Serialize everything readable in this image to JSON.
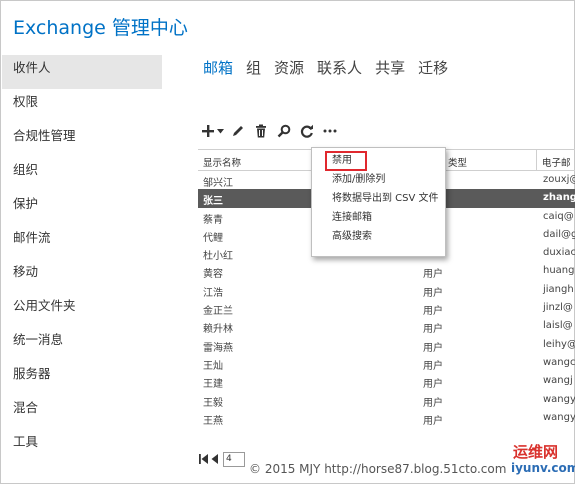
{
  "app": {
    "title": "Exchange 管理中心"
  },
  "sidebar": {
    "items": [
      {
        "label": "收件人",
        "active": true
      },
      {
        "label": "权限"
      },
      {
        "label": "合规性管理"
      },
      {
        "label": "组织"
      },
      {
        "label": "保护"
      },
      {
        "label": "邮件流"
      },
      {
        "label": "移动"
      },
      {
        "label": "公用文件夹"
      },
      {
        "label": "统一消息"
      },
      {
        "label": "服务器"
      },
      {
        "label": "混合"
      },
      {
        "label": "工具"
      }
    ]
  },
  "tabs": [
    {
      "label": "邮箱",
      "active": true
    },
    {
      "label": "组"
    },
    {
      "label": "资源"
    },
    {
      "label": "联系人"
    },
    {
      "label": "共享"
    },
    {
      "label": "迁移"
    }
  ],
  "toolbar": {
    "icons": [
      "add-icon",
      "dropdown-arrow-icon",
      "edit-icon",
      "delete-icon",
      "search-icon",
      "refresh-icon",
      "more-icon"
    ]
  },
  "grid": {
    "headers": {
      "name": "显示名称",
      "type": "类型",
      "email": "电子邮"
    },
    "rows": [
      {
        "name": "邹兴江",
        "type": "",
        "email": "zouxj@"
      },
      {
        "name": "张三",
        "type": "",
        "email": "zhang",
        "selected": true
      },
      {
        "name": "蔡青",
        "type": "",
        "email": "caiq@"
      },
      {
        "name": "代鲤",
        "type": "",
        "email": "dail@g"
      },
      {
        "name": "杜小红",
        "type": "",
        "email": "duxiac"
      },
      {
        "name": "黄容",
        "type": "用户",
        "email": "huang"
      },
      {
        "name": "江浩",
        "type": "用户",
        "email": "jiangh"
      },
      {
        "name": "金正兰",
        "type": "用户",
        "email": "jinzl@"
      },
      {
        "name": "赖升林",
        "type": "用户",
        "email": "laisl@"
      },
      {
        "name": "雷海燕",
        "type": "用户",
        "email": "leihy@"
      },
      {
        "name": "王灿",
        "type": "用户",
        "email": "wangc"
      },
      {
        "name": "王建",
        "type": "用户",
        "email": "wangj"
      },
      {
        "name": "王毅",
        "type": "用户",
        "email": "wangyi"
      },
      {
        "name": "王燕",
        "type": "用户",
        "email": "wangy"
      }
    ]
  },
  "context_menu": {
    "items": [
      "禁用",
      "添加/删除列",
      "将数据导出到 CSV 文件",
      "连接邮箱",
      "高级搜索"
    ],
    "highlighted_item": "禁用"
  },
  "pager": {
    "page": "4"
  },
  "watermark": {
    "text": "© 2015 MJY http://horse87.blog.51cto.com"
  },
  "logo": {
    "top": "运维网",
    "bottom": "iyunv.com"
  },
  "colors": {
    "accent": "#0072c6",
    "selected_row": "#5a5a5a",
    "highlight_border": "#e0282e"
  }
}
